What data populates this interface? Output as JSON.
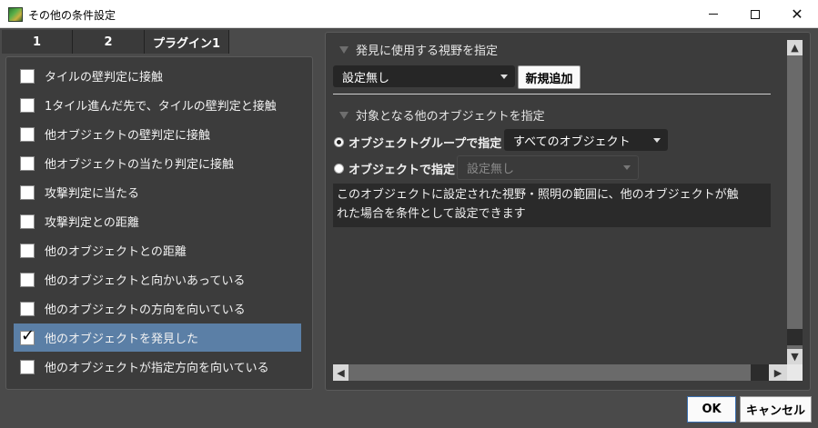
{
  "window": {
    "title": "その他の条件設定",
    "minimize_glyph": "",
    "maximize_glyph": "",
    "close_glyph": "✕"
  },
  "tabs": [
    {
      "label": "1",
      "active": false
    },
    {
      "label": "2",
      "active": false
    },
    {
      "label": "プラグイン1",
      "active": false
    }
  ],
  "conditions": [
    {
      "label": "タイルの壁判定に接触",
      "checked": false
    },
    {
      "label": "1タイル進んだ先で、タイルの壁判定と接触",
      "checked": false
    },
    {
      "label": "他オブジェクトの壁判定に接触",
      "checked": false
    },
    {
      "label": "他オブジェクトの当たり判定に接触",
      "checked": false
    },
    {
      "label": "攻撃判定に当たる",
      "checked": false
    },
    {
      "label": "攻撃判定との距離",
      "checked": false
    },
    {
      "label": "他のオブジェクトとの距離",
      "checked": false
    },
    {
      "label": "他のオブジェクトと向かいあっている",
      "checked": false
    },
    {
      "label": "他のオブジェクトの方向を向いている",
      "checked": false
    },
    {
      "label": "他のオブジェクトを発見した",
      "checked": true
    },
    {
      "label": "他のオブジェクトが指定方向を向いている",
      "checked": false
    }
  ],
  "detail": {
    "view_section_title": "発見に使用する視野を指定",
    "view_select_value": "設定無し",
    "add_button_label": "新規追加",
    "target_section_title": "対象となる他のオブジェクトを指定",
    "group_radio_label": "オブジェクトグループで指定",
    "group_select_value": "すべてのオブジェクト",
    "object_radio_label": "オブジェクトで指定",
    "object_select_value": "設定無し",
    "description_line1": "このオブジェクトに設定された視野・照明の範囲に、他のオブジェクトが触",
    "description_line2": "れた場合を条件として設定できます",
    "selected_radio": "group"
  },
  "buttons": {
    "ok_label": "OK",
    "cancel_label": "キャンセル"
  },
  "colors": {
    "selected_row": "#5b7fa6",
    "background": "#4a4a4a"
  }
}
